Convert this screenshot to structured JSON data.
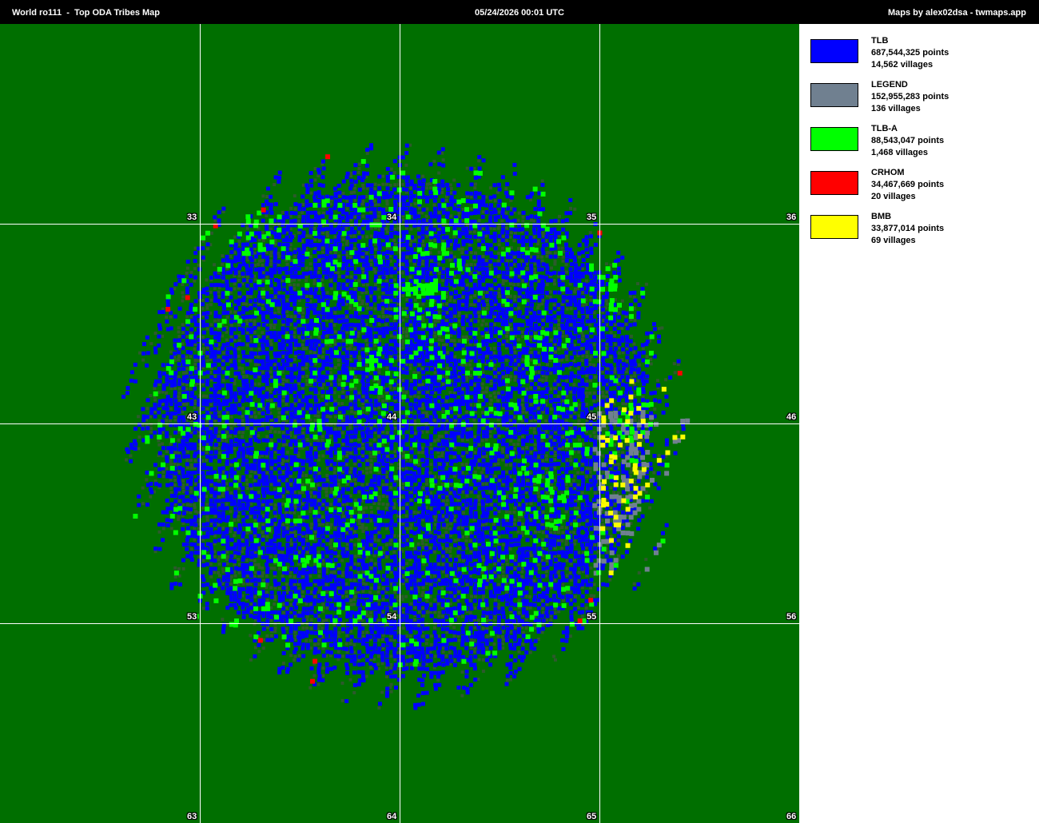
{
  "header": {
    "title": "World ro111  -  Top ODA Tribes Map",
    "timestamp": "05/24/2026 00:01 UTC",
    "credit": "Maps by alex02dsa - twmaps.app"
  },
  "map": {
    "background_color": "#006f00",
    "village_color": "#2c5a2c",
    "grid_color": "#ffffff",
    "continent_labels": [
      "33",
      "34",
      "35",
      "36",
      "43",
      "44",
      "45",
      "46",
      "53",
      "54",
      "55",
      "56",
      "63",
      "64",
      "65",
      "66"
    ]
  },
  "legend": [
    {
      "name": "TLB",
      "points": "687,544,325 points",
      "villages": "14,562 villages",
      "color": "#0000ff"
    },
    {
      "name": "LEGEND",
      "points": "152,955,283 points",
      "villages": "136 villages",
      "color": "#708090"
    },
    {
      "name": "TLB-A",
      "points": "88,543,047 points",
      "villages": "1,468 villages",
      "color": "#00ff00"
    },
    {
      "name": "CRHOM",
      "points": "34,467,669 points",
      "villages": "20 villages",
      "color": "#ff0000"
    },
    {
      "name": "BMB",
      "points": "33,877,014 points",
      "villages": "69 villages",
      "color": "#ffff00"
    }
  ]
}
